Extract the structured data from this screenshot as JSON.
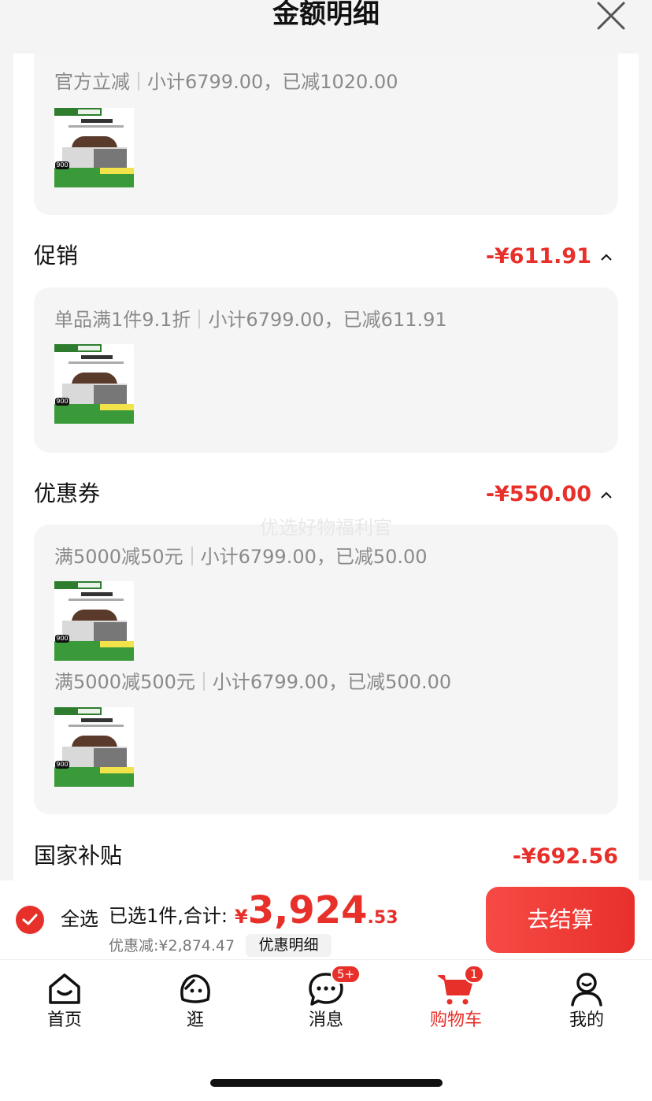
{
  "header": {
    "title": "金额明细"
  },
  "official": {
    "name": "官方立减",
    "detail": "小计6799.00，已减1020.00"
  },
  "promo": {
    "title": "促销",
    "amount": "-¥611.91",
    "name": "单品满1件9.1折",
    "detail": "小计6799.00，已减611.91"
  },
  "coupon": {
    "title": "优惠券",
    "amount": "-¥550.00",
    "items": [
      {
        "name": "满5000减50元",
        "detail": "小计6799.00，已减50.00"
      },
      {
        "name": "满5000减500元",
        "detail": "小计6799.00，已减500.00"
      }
    ]
  },
  "subsidy": {
    "title": "国家补贴",
    "amount": "-¥692.56"
  },
  "watermark": "优选好物福利官",
  "product_thumb": {
    "badge": "900"
  },
  "cart": {
    "select_all": "全选",
    "selected_text": "已选1件,合计:",
    "currency": "¥",
    "total_int": "3,924",
    "total_dec": ".53",
    "discount_text": "优惠减:¥2,874.47",
    "detail_button": "优惠明细",
    "checkout_button": "去结算"
  },
  "tabs": [
    {
      "label": "首页",
      "icon": "home-icon"
    },
    {
      "label": "逛",
      "icon": "browse-icon"
    },
    {
      "label": "消息",
      "icon": "message-icon",
      "badge": "5+"
    },
    {
      "label": "购物车",
      "icon": "cart-icon",
      "badge": "1",
      "active": true
    },
    {
      "label": "我的",
      "icon": "profile-icon"
    }
  ],
  "colors": {
    "accent": "#e8302b",
    "card_bg": "#f5f5f5",
    "muted_text": "#8a8a8a"
  }
}
